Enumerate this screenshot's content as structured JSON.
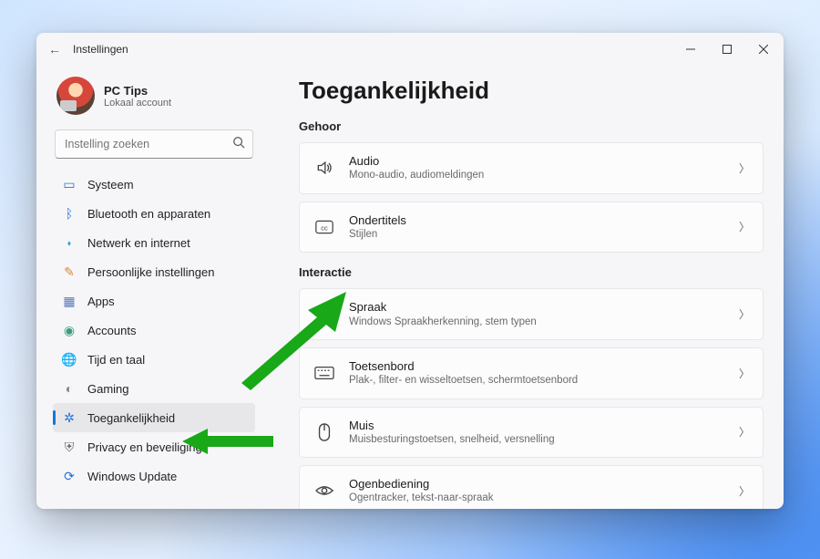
{
  "window": {
    "title": "Instellingen"
  },
  "profile": {
    "name": "PC Tips",
    "account": "Lokaal account"
  },
  "search": {
    "placeholder": "Instelling zoeken"
  },
  "sidebar": {
    "items": [
      {
        "label": "Systeem"
      },
      {
        "label": "Bluetooth en apparaten"
      },
      {
        "label": "Netwerk en internet"
      },
      {
        "label": "Persoonlijke instellingen"
      },
      {
        "label": "Apps"
      },
      {
        "label": "Accounts"
      },
      {
        "label": "Tijd en taal"
      },
      {
        "label": "Gaming"
      },
      {
        "label": "Toegankelijkheid"
      },
      {
        "label": "Privacy en beveiliging"
      },
      {
        "label": "Windows Update"
      }
    ]
  },
  "page": {
    "title": "Toegankelijkheid"
  },
  "sections": {
    "gehoor": {
      "heading": "Gehoor",
      "items": [
        {
          "title": "Audio",
          "subtitle": "Mono-audio, audiomeldingen"
        },
        {
          "title": "Ondertitels",
          "subtitle": "Stijlen"
        }
      ]
    },
    "interactie": {
      "heading": "Interactie",
      "items": [
        {
          "title": "Spraak",
          "subtitle": "Windows Spraakherkenning, stem typen"
        },
        {
          "title": "Toetsenbord",
          "subtitle": "Plak-, filter- en wisseltoetsen, schermtoetsenbord"
        },
        {
          "title": "Muis",
          "subtitle": "Muisbesturingstoetsen, snelheid, versnelling"
        },
        {
          "title": "Ogenbediening",
          "subtitle": "Ogentracker, tekst-naar-spraak"
        }
      ]
    }
  }
}
